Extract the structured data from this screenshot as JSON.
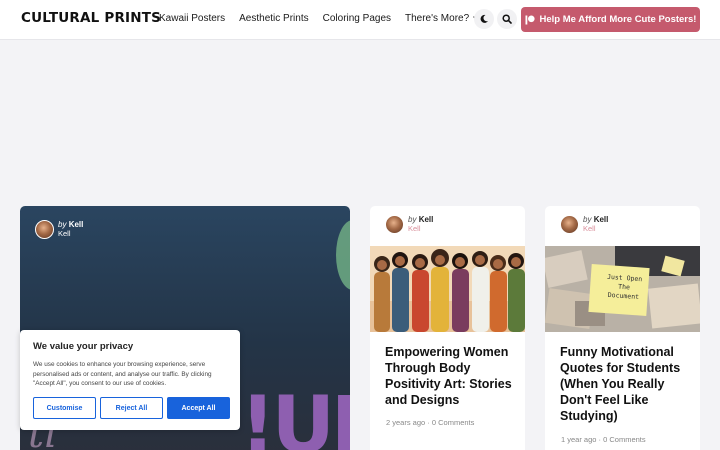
{
  "header": {
    "logo": "CULTURAL PRINTS",
    "nav": [
      "Kawaii Posters",
      "Aesthetic Prints",
      "Coloring Pages",
      "There's More?"
    ],
    "cta_label": "Help Me Afford More Cute Posters!"
  },
  "featured": {
    "author_by": "by",
    "author_name": "Kell",
    "author_sub": "Kell",
    "graphic_letters": "!URS",
    "graphic_script": "ti"
  },
  "posts": [
    {
      "author_by": "by",
      "author_name": "Kell",
      "author_sub": "Kell",
      "title": "Empowering Women Through Body Positivity Art: Stories and Designs",
      "age": "2 years ago",
      "comments": "0 Comments"
    },
    {
      "author_by": "by",
      "author_name": "Kell",
      "author_sub": "Kell",
      "title": "Funny Motivational Quotes for Students (When You Really Don't Feel Like Studying)",
      "age": "1 year ago",
      "comments": "0 Comments",
      "sticky_note": "Just Open The Document"
    }
  ],
  "cookie": {
    "title": "We value your privacy",
    "text": "We use cookies to enhance your browsing experience, serve personalised ads or content, and analyse our traffic. By clicking \"Accept All\", you consent to our use of cookies.",
    "customise": "Customise",
    "reject": "Reject All",
    "accept": "Accept All"
  },
  "colors": {
    "accent": "#c55a6d",
    "cookie_blue": "#1863dc"
  }
}
